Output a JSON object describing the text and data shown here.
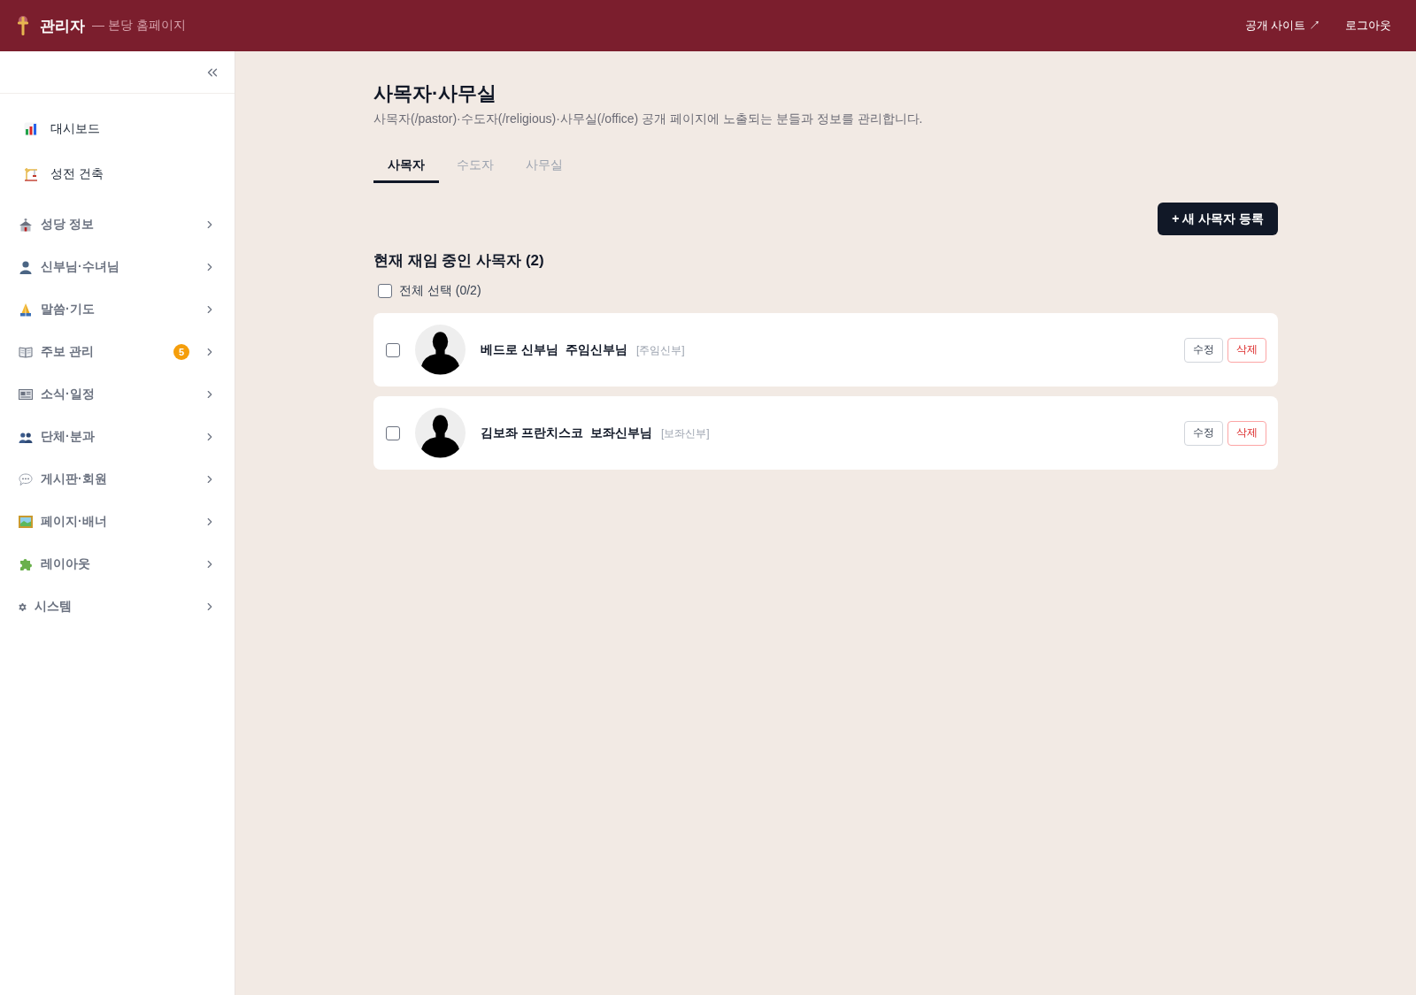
{
  "header": {
    "title": "관리자",
    "subtitle": "— 본당 홈페이지",
    "links": [
      {
        "label": "공개 사이트 ↗"
      },
      {
        "label": "로그아웃"
      }
    ]
  },
  "sidebar": {
    "items": [
      {
        "kind": "link",
        "label": "대시보드"
      },
      {
        "kind": "link",
        "label": "성전 건축"
      },
      {
        "kind": "group",
        "label": "성당 정보",
        "expanded": false
      },
      {
        "kind": "group",
        "label": "신부님·수녀님",
        "expanded": false
      },
      {
        "kind": "group",
        "label": "말씀·기도",
        "expanded": false
      },
      {
        "kind": "group",
        "label": "주보 관리",
        "badge": "5",
        "expanded": false
      },
      {
        "kind": "group",
        "label": "소식·일정",
        "expanded": false
      },
      {
        "kind": "group",
        "label": "단체·분과",
        "expanded": false
      },
      {
        "kind": "group",
        "label": "게시판·회원",
        "expanded": false
      },
      {
        "kind": "group",
        "label": "페이지·배너",
        "expanded": false
      },
      {
        "kind": "group",
        "label": "레이아웃",
        "expanded": false
      },
      {
        "kind": "group",
        "label": "시스템",
        "expanded": false
      }
    ]
  },
  "page": {
    "title": "사목자·사무실",
    "description": "사목자(/pastor)·수도자(/religious)·사무실(/office) 공개 페이지에 노출되는 분들과 정보를 관리합니다."
  },
  "tabs": [
    {
      "label": "사목자",
      "selected": true
    },
    {
      "label": "수도자",
      "selected": false
    },
    {
      "label": "사무실",
      "selected": false
    }
  ],
  "add_button": {
    "label": "+ 새 사목자 등록"
  },
  "list": {
    "title": "현재 재임 중인 사목자 (2)",
    "select_all": {
      "label": "전체 선택 (0/2)",
      "checked": false
    },
    "rows": [
      {
        "name": "베드로 신부님",
        "position": "주임신부님",
        "role": "[주임신부]",
        "checked": false,
        "actions": [
          {
            "kind": "edit",
            "label": "수정"
          },
          {
            "kind": "delete",
            "label": "삭제"
          }
        ]
      },
      {
        "name": "김보좌 프란치스코",
        "position": "보좌신부님",
        "role": "[보좌신부]",
        "checked": false,
        "actions": [
          {
            "kind": "edit",
            "label": "수정"
          },
          {
            "kind": "delete",
            "label": "삭제"
          }
        ]
      }
    ]
  }
}
